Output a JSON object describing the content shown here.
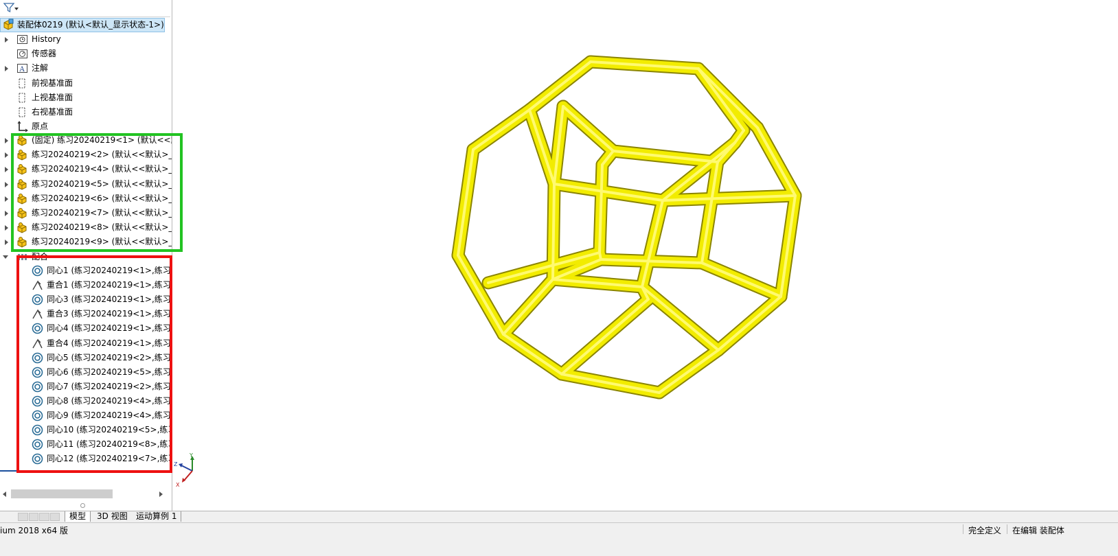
{
  "tree": {
    "root_label": "装配体0219 (默认<默认_显示状态-1>)",
    "items": [
      {
        "label": "History",
        "icon": "history-icon",
        "expandable": true
      },
      {
        "label": "传感器",
        "icon": "sensor-icon",
        "expandable": false
      },
      {
        "label": "注解",
        "icon": "annotation-icon",
        "expandable": true
      },
      {
        "label": "前视基准面",
        "icon": "plane-icon",
        "expandable": false
      },
      {
        "label": "上视基准面",
        "icon": "plane-icon",
        "expandable": false
      },
      {
        "label": "右视基准面",
        "icon": "plane-icon",
        "expandable": false
      },
      {
        "label": "原点",
        "icon": "origin-icon",
        "expandable": false
      }
    ],
    "components": [
      "(固定) 练习20240219<1> (默认<<默认",
      "练习20240219<2> (默认<<默认>_显",
      "练习20240219<4> (默认<<默认>_显",
      "练习20240219<5> (默认<<默认>_显",
      "练习20240219<6> (默认<<默认>_显",
      "练习20240219<7> (默认<<默认>_显",
      "练习20240219<8> (默认<<默认>_显",
      "练习20240219<9> (默认<<默认>_显"
    ],
    "mates_folder": "配合",
    "mates": [
      {
        "label": "同心1 (练习20240219<1>,练习2",
        "type": "concentric"
      },
      {
        "label": "重合1 (练习20240219<1>,练习2",
        "type": "coincident"
      },
      {
        "label": "同心3 (练习20240219<1>,练习2",
        "type": "concentric"
      },
      {
        "label": "重合3 (练习20240219<1>,练习2",
        "type": "coincident"
      },
      {
        "label": "同心4 (练习20240219<1>,练习2",
        "type": "concentric"
      },
      {
        "label": "重合4 (练习20240219<1>,练习2",
        "type": "coincident"
      },
      {
        "label": "同心5 (练习20240219<2>,练习2",
        "type": "concentric"
      },
      {
        "label": "同心6 (练习20240219<5>,练习2",
        "type": "concentric"
      },
      {
        "label": "同心7 (练习20240219<2>,练习2",
        "type": "concentric"
      },
      {
        "label": "同心8 (练习20240219<4>,练习2",
        "type": "concentric"
      },
      {
        "label": "同心9 (练习20240219<4>,练习2",
        "type": "concentric"
      },
      {
        "label": "同心10 (练习20240219<5>,练习",
        "type": "concentric"
      },
      {
        "label": "同心11 (练习20240219<8>,练习",
        "type": "concentric"
      },
      {
        "label": "同心12 (练习20240219<7>,练习",
        "type": "concentric"
      }
    ]
  },
  "tabs": [
    {
      "label": "模型",
      "active": true
    },
    {
      "label": "3D 视图",
      "active": false
    },
    {
      "label": "运动算例 1",
      "active": false
    }
  ],
  "status": {
    "left": "ium 2018 x64 版",
    "definition": "完全定义",
    "editing": "在编辑 装配体"
  },
  "triad": {
    "x": "X",
    "y": "Y",
    "z": "Z"
  },
  "colors": {
    "model": "#f2ec00",
    "green_highlight": "#22c322",
    "red_highlight": "#ee1111",
    "selection": "#cde6f7"
  }
}
